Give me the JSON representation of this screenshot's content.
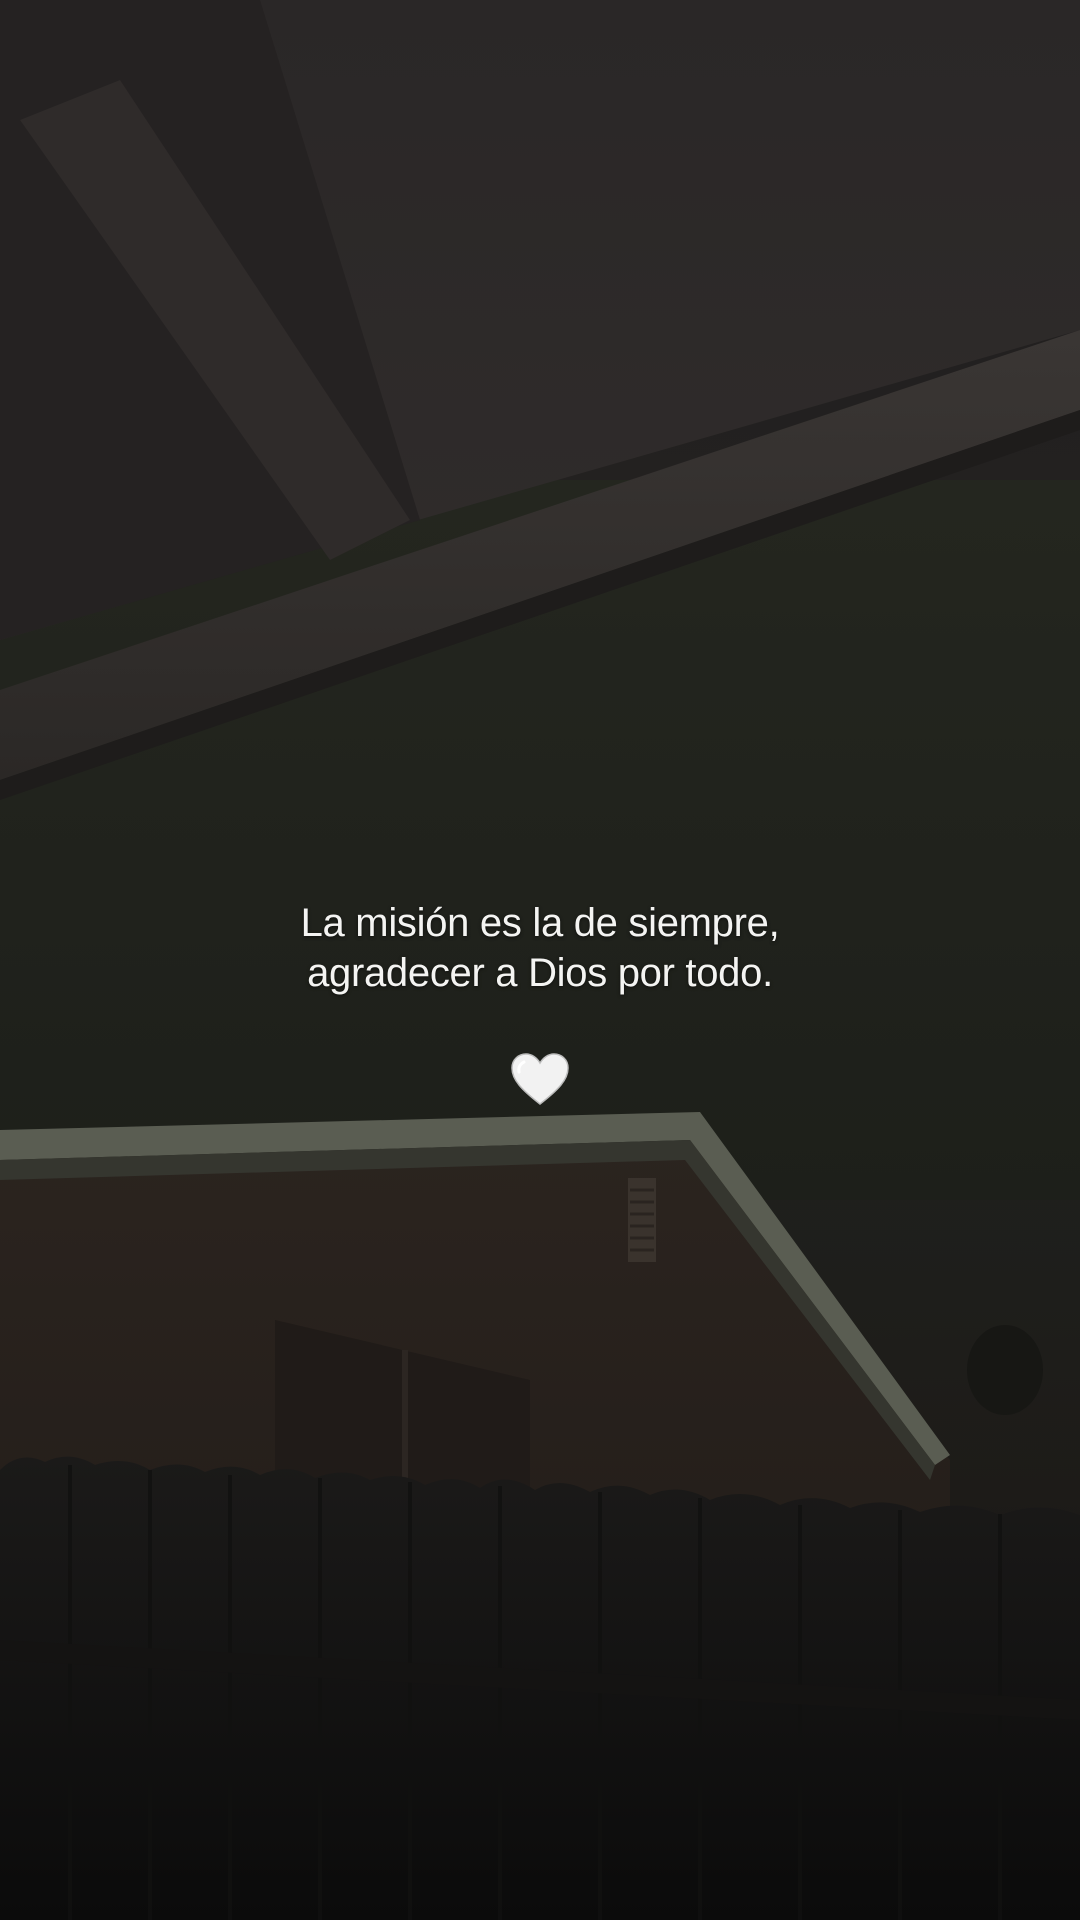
{
  "caption": {
    "line1": "La misión es la de siempre,",
    "line2": "agradecer a Dios por todo."
  },
  "emoji": {
    "name": "white-heart-icon",
    "color": "#f2f2f2"
  },
  "colors": {
    "text": "#f4f4f2",
    "background_dark": "#1a1a18"
  }
}
